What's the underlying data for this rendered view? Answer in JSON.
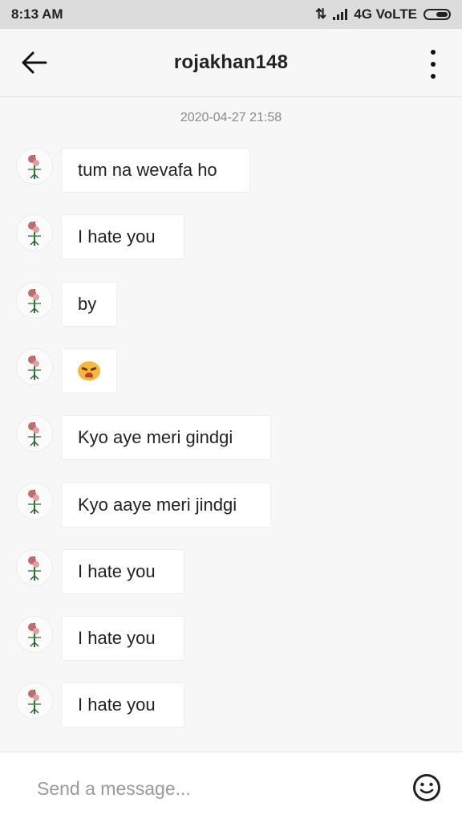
{
  "status_bar": {
    "time": "8:13 AM",
    "network": "4G VoLTE"
  },
  "header": {
    "title": "rojakhan148",
    "back_icon": "back-arrow-icon",
    "menu_icon": "more-vertical-icon"
  },
  "conversation": {
    "timestamp": "2020-04-27 21:58",
    "messages": [
      {
        "text": "tum na wevafa ho"
      },
      {
        "text": "I hate you"
      },
      {
        "text": "by"
      },
      {
        "emoji": "angry-crying-face-emoji"
      },
      {
        "text": "Kyo aye meri gindgi"
      },
      {
        "text": "Kyo aaye meri jindgi"
      },
      {
        "text": "I hate you"
      },
      {
        "text": "I hate you"
      },
      {
        "text": "I hate you"
      }
    ]
  },
  "composer": {
    "placeholder": "Send a message...",
    "emoji_icon": "smiley-face-icon"
  },
  "colors": {
    "background": "#f7f7f7",
    "status_bar": "#dcdcdc",
    "bubble": "#ffffff",
    "timestamp": "#8a8a8a"
  }
}
